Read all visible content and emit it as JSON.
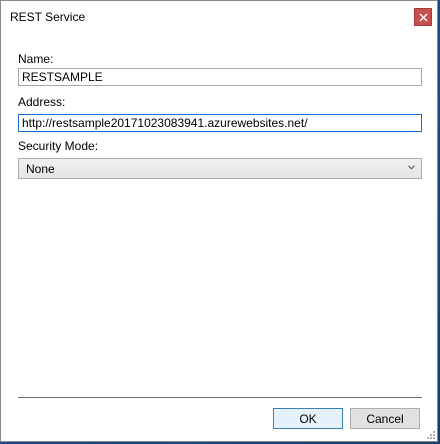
{
  "window": {
    "title": "REST Service",
    "accent_color": "#c75050"
  },
  "form": {
    "name_label": "Name:",
    "name_value": "RESTSAMPLE",
    "address_label": "Address:",
    "address_value": "http://restsample20171023083941.azurewebsites.net/",
    "security_label": "Security Mode:",
    "security_selected": "None"
  },
  "buttons": {
    "ok_label": "OK",
    "cancel_label": "Cancel"
  },
  "icons": {
    "close": "close-icon",
    "dropdown": "chevron-down-icon",
    "grip": "resize-grip-icon"
  }
}
